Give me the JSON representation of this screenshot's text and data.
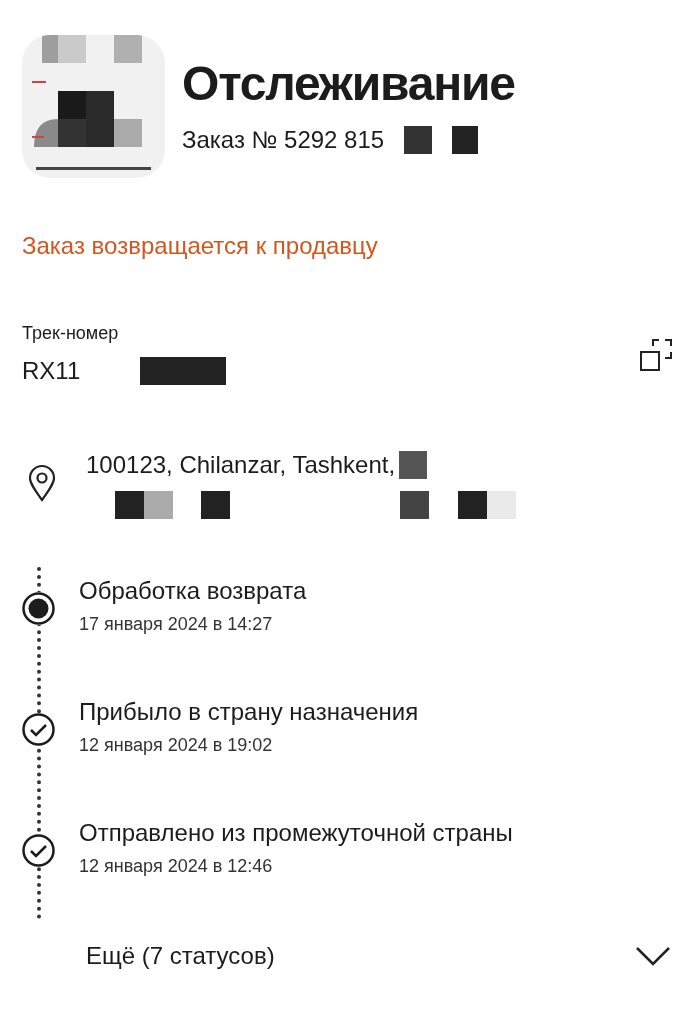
{
  "header": {
    "title": "Отслеживание",
    "order_number": "Заказ № 5292 815"
  },
  "status": "Заказ возвращается к продавцу",
  "tracking": {
    "label": "Трек-номер",
    "number": "RX11"
  },
  "address": {
    "line_1": "100123, Chilanzar, Tashkent,"
  },
  "events": [
    {
      "kind": "current",
      "title": "Обработка возврата",
      "date": "17 января 2024 в 14:27"
    },
    {
      "kind": "done",
      "title": "Прибыло в страну назначения",
      "date": "12 января 2024 в 19:02"
    },
    {
      "kind": "done",
      "title": "Отправлено из промежуточной страны",
      "date": "12 января 2024 в 12:46"
    }
  ],
  "more": {
    "label": "Ещё (7 статусов)",
    "expanded": false
  }
}
